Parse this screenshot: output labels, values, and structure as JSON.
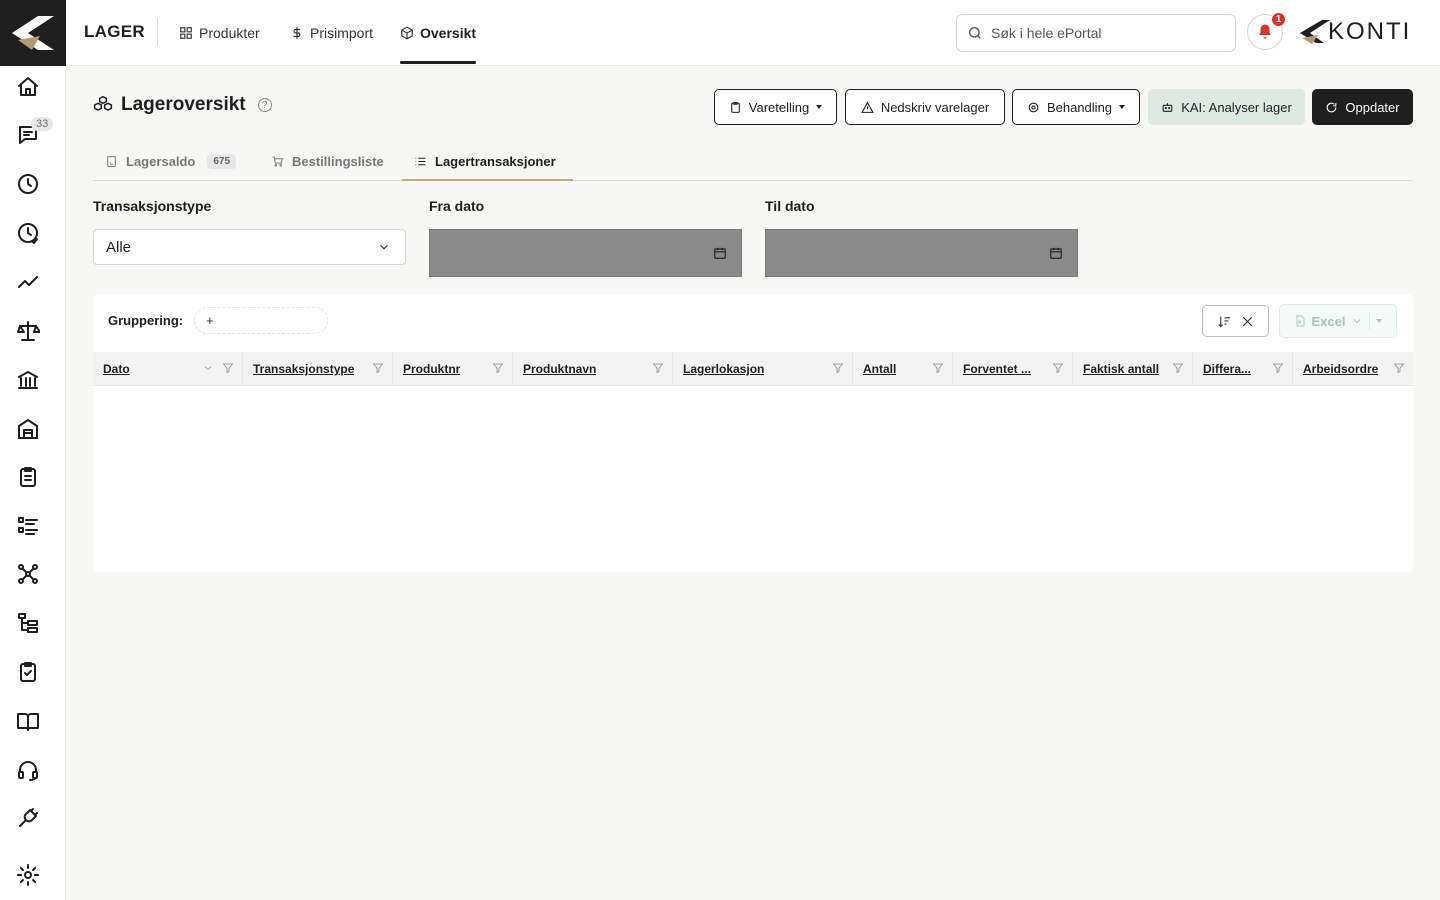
{
  "sidebar": {
    "chat_badge": "33",
    "icons": [
      "home-icon",
      "chat-icon",
      "clock-icon",
      "history-icon",
      "trend-icon",
      "scale-icon",
      "bank-icon",
      "warehouse-icon",
      "clipboard-list-icon",
      "list-icon",
      "network-icon",
      "tree-icon",
      "clipboard-check-icon",
      "book-icon",
      "headset-icon",
      "plug-icon",
      "settings-icon"
    ]
  },
  "topbar": {
    "app_title": "LAGER",
    "nav": [
      {
        "label": "Produkter",
        "icon": "grid-icon"
      },
      {
        "label": "Prisimport",
        "icon": "dollar-icon"
      },
      {
        "label": "Oversikt",
        "icon": "box-icon",
        "active": true
      }
    ],
    "search_placeholder": "Søk i hele ePortal",
    "notification_count": "1",
    "brand": "KONTI"
  },
  "page": {
    "title": "Lageroversikt",
    "help": "?",
    "buttons": {
      "varetelling": "Varetelling",
      "nedskriv": "Nedskriv varelager",
      "behandling": "Behandling",
      "kai": "KAI: Analyser lager",
      "oppdater": "Oppdater"
    },
    "tabs": [
      {
        "label": "Lagersaldo",
        "count": "675"
      },
      {
        "label": "Bestillingsliste"
      },
      {
        "label": "Lagertransaksjoner",
        "active": true
      }
    ]
  },
  "filters": {
    "type_label": "Transaksjonstype",
    "type_value": "Alle",
    "from_label": "Fra dato",
    "to_label": "Til dato"
  },
  "grid": {
    "grouping_label": "Gruppering:",
    "grouping_add": "+",
    "excel_label": "Excel",
    "columns": [
      "Dato",
      "Transaksjonstype",
      "Produktnr",
      "Produktnavn",
      "Lagerlokasjon",
      "Antall",
      "Forventet ...",
      "Faktisk antall",
      "Differa...",
      "Arbeidsordre"
    ],
    "rows": []
  },
  "colors": {
    "accent_dark": "#1f1f1f",
    "kai_bg": "#dfe9e4",
    "tab_underline": "#c9a77c",
    "notification": "#d9322b",
    "date_field_bg": "#8a8a8a"
  }
}
